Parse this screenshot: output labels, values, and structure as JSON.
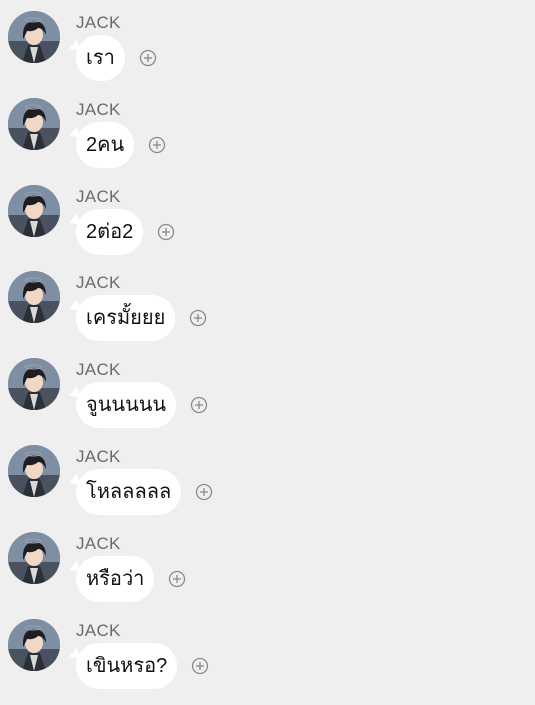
{
  "messages": [
    {
      "sender": "JACK",
      "text": "เรา"
    },
    {
      "sender": "JACK",
      "text": "2คน"
    },
    {
      "sender": "JACK",
      "text": "2ต่อ2"
    },
    {
      "sender": "JACK",
      "text": "เครมั้ยยย"
    },
    {
      "sender": "JACK",
      "text": "จูนนนนน"
    },
    {
      "sender": "JACK",
      "text": "โหลลลลล"
    },
    {
      "sender": "JACK",
      "text": "หรือว่า"
    },
    {
      "sender": "JACK",
      "text": "เขินหรอ?"
    }
  ],
  "icons": {
    "avatar": "user-avatar-icon",
    "react": "add-reaction-icon"
  },
  "colors": {
    "background": "#efefef",
    "bubble": "#ffffff",
    "sender_name": "#6b6b6b"
  }
}
